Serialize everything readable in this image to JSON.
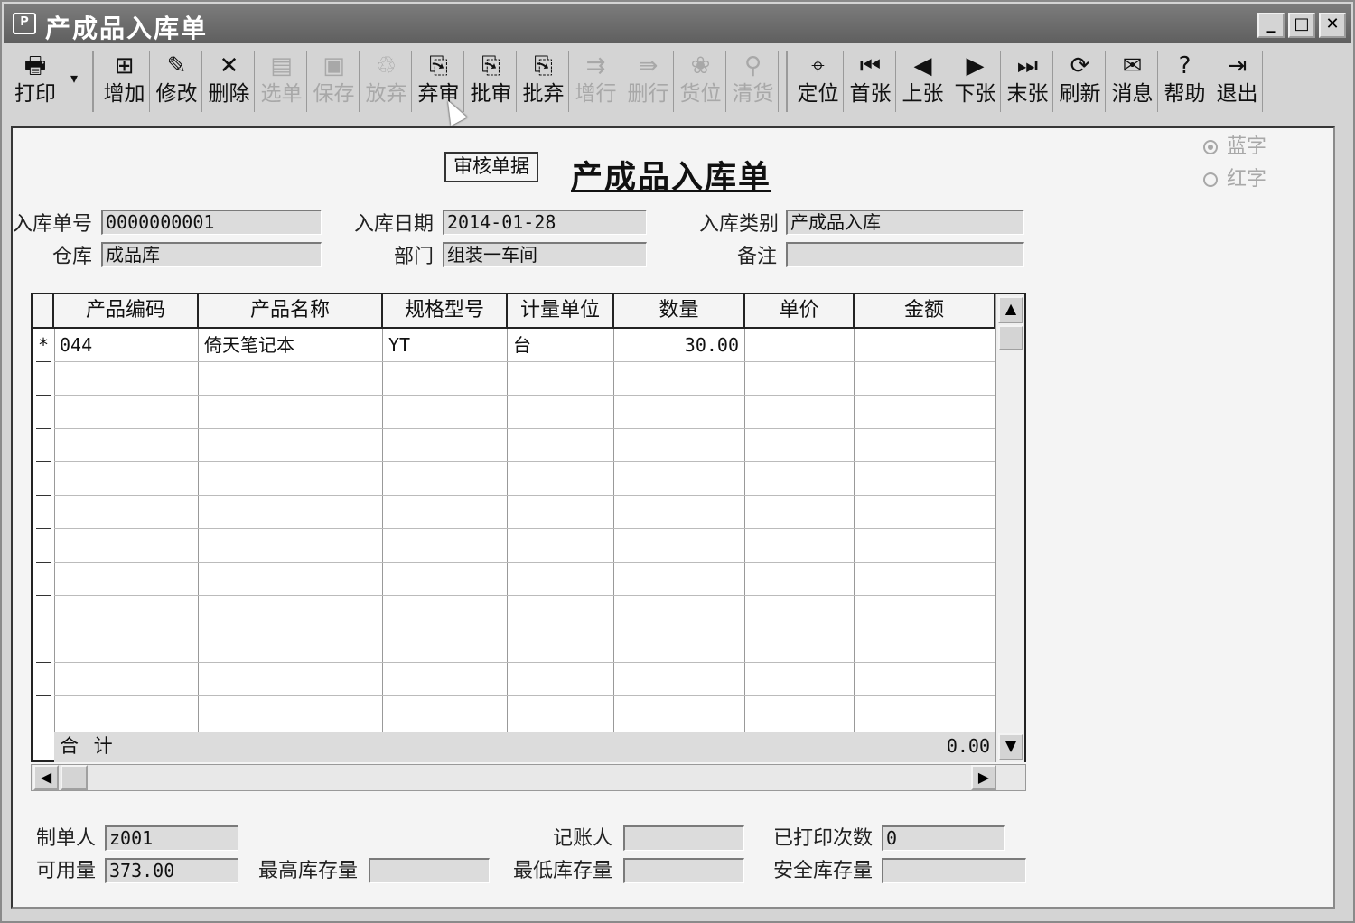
{
  "window": {
    "title": "产成品入库单",
    "icon_glyph": "P"
  },
  "toolbar": {
    "buttons": [
      {
        "label": "打印",
        "icon": "printer-icon",
        "glyph": "🖶"
      },
      {
        "label": "增加",
        "icon": "add-document-icon",
        "glyph": "⊞"
      },
      {
        "label": "修改",
        "icon": "edit-icon",
        "glyph": "✎"
      },
      {
        "label": "删除",
        "icon": "delete-icon",
        "glyph": "✕"
      },
      {
        "label": "选单",
        "icon": "select-order-icon",
        "glyph": "▤"
      },
      {
        "label": "保存",
        "icon": "save-icon",
        "glyph": "▣"
      },
      {
        "label": "放弃",
        "icon": "discard-icon",
        "glyph": "♲"
      },
      {
        "label": "弃审",
        "icon": "unaudit-icon",
        "glyph": "⎘"
      },
      {
        "label": "批审",
        "icon": "batch-audit-icon",
        "glyph": "⎘"
      },
      {
        "label": "批弃",
        "icon": "batch-discard-icon",
        "glyph": "⎘"
      },
      {
        "label": "增行",
        "icon": "add-row-icon",
        "glyph": "⇉"
      },
      {
        "label": "删行",
        "icon": "delete-row-icon",
        "glyph": "⇛"
      },
      {
        "label": "货位",
        "icon": "location-icon",
        "glyph": "❀"
      },
      {
        "label": "清货",
        "icon": "clear-goods-icon",
        "glyph": "⚲"
      },
      {
        "label": "定位",
        "icon": "locate-icon",
        "glyph": "⌖"
      },
      {
        "label": "首张",
        "icon": "first-icon",
        "glyph": "⏮"
      },
      {
        "label": "上张",
        "icon": "previous-icon",
        "glyph": "◀"
      },
      {
        "label": "下张",
        "icon": "next-icon",
        "glyph": "▶"
      },
      {
        "label": "末张",
        "icon": "last-icon",
        "glyph": "⏭"
      },
      {
        "label": "刷新",
        "icon": "refresh-icon",
        "glyph": "⟳"
      },
      {
        "label": "消息",
        "icon": "message-icon",
        "glyph": "✉"
      },
      {
        "label": "帮助",
        "icon": "help-icon",
        "glyph": "?"
      },
      {
        "label": "退出",
        "icon": "exit-icon",
        "glyph": "⇥"
      }
    ],
    "dropdown_glyph": "▾"
  },
  "form": {
    "audit_button": "审核单据",
    "doc_title": "产成品入库单",
    "radio_blue": "蓝字",
    "radio_red": "红字",
    "labels": {
      "doc_no": "入库单号",
      "warehouse": "仓库",
      "date": "入库日期",
      "dept": "部门",
      "category": "入库类别",
      "remark": "备注"
    },
    "values": {
      "doc_no": "0000000001",
      "warehouse": "成品库",
      "date": "2014-01-28",
      "dept": "组装一车间",
      "category": "产成品入库",
      "remark": ""
    }
  },
  "grid": {
    "columns": [
      "产品编码",
      "产品名称",
      "规格型号",
      "计量单位",
      "数量",
      "单价",
      "金额"
    ],
    "rows": [
      {
        "marker": "*",
        "code": "044",
        "name": "倚天笔记本",
        "spec": "YT",
        "unit": "台",
        "qty": "30.00",
        "price": "",
        "amount": ""
      }
    ],
    "sum_label": "合 计",
    "sum_amount": "0.00"
  },
  "footer": {
    "labels": {
      "maker": "制单人",
      "available": "可用量",
      "max_stock": "最高库存量",
      "bookkeeper": "记账人",
      "min_stock": "最低库存量",
      "print_count": "已打印次数",
      "safe_stock": "安全库存量"
    },
    "values": {
      "maker": "z001",
      "available": "373.00",
      "max_stock": "",
      "bookkeeper": "",
      "min_stock": "",
      "print_count": "0",
      "safe_stock": ""
    }
  }
}
